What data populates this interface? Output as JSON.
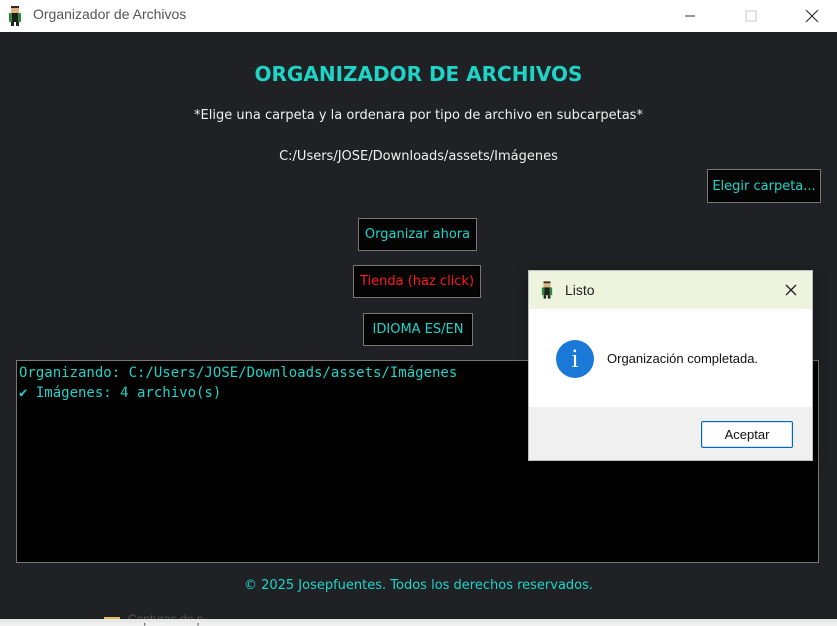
{
  "window": {
    "title": "Organizador de Archivos",
    "controls": {
      "minimize": "minimize-icon",
      "maximize": "maximize-icon",
      "close": "close-icon"
    }
  },
  "main": {
    "heading": "ORGANIZADOR DE ARCHIVOS",
    "subtitle": "*Elige una carpeta y la ordenara por tipo de archivo en subcarpetas*",
    "selected_path": "C:/Users/JOSE/Downloads/assets/Imágenes",
    "buttons": {
      "choose_folder": "Elegir carpeta...",
      "organize_now": "Organizar ahora",
      "store": "Tienda (haz click)",
      "language": "IDIOMA ES/EN"
    },
    "console": {
      "lines": [
        "Organizando: C:/Users/JOSE/Downloads/assets/Imágenes",
        "✔ Imágenes: 4 archivo(s)"
      ]
    },
    "footer": "© 2025 Josepfuentes. Todos los derechos reservados."
  },
  "dialog": {
    "title": "Listo",
    "icon": "info-icon",
    "message": "Organización completada.",
    "ok_label": "Aceptar"
  },
  "background": {
    "taskbar_peek_text": "Capturas de p..."
  },
  "colors": {
    "accent": "#1fd3c7",
    "store_text": "#ff1a1a",
    "window_bg": "#1f2124",
    "console_bg": "#000000",
    "dialog_title_bg": "#eef3dd",
    "info_icon": "#1a78d6"
  }
}
